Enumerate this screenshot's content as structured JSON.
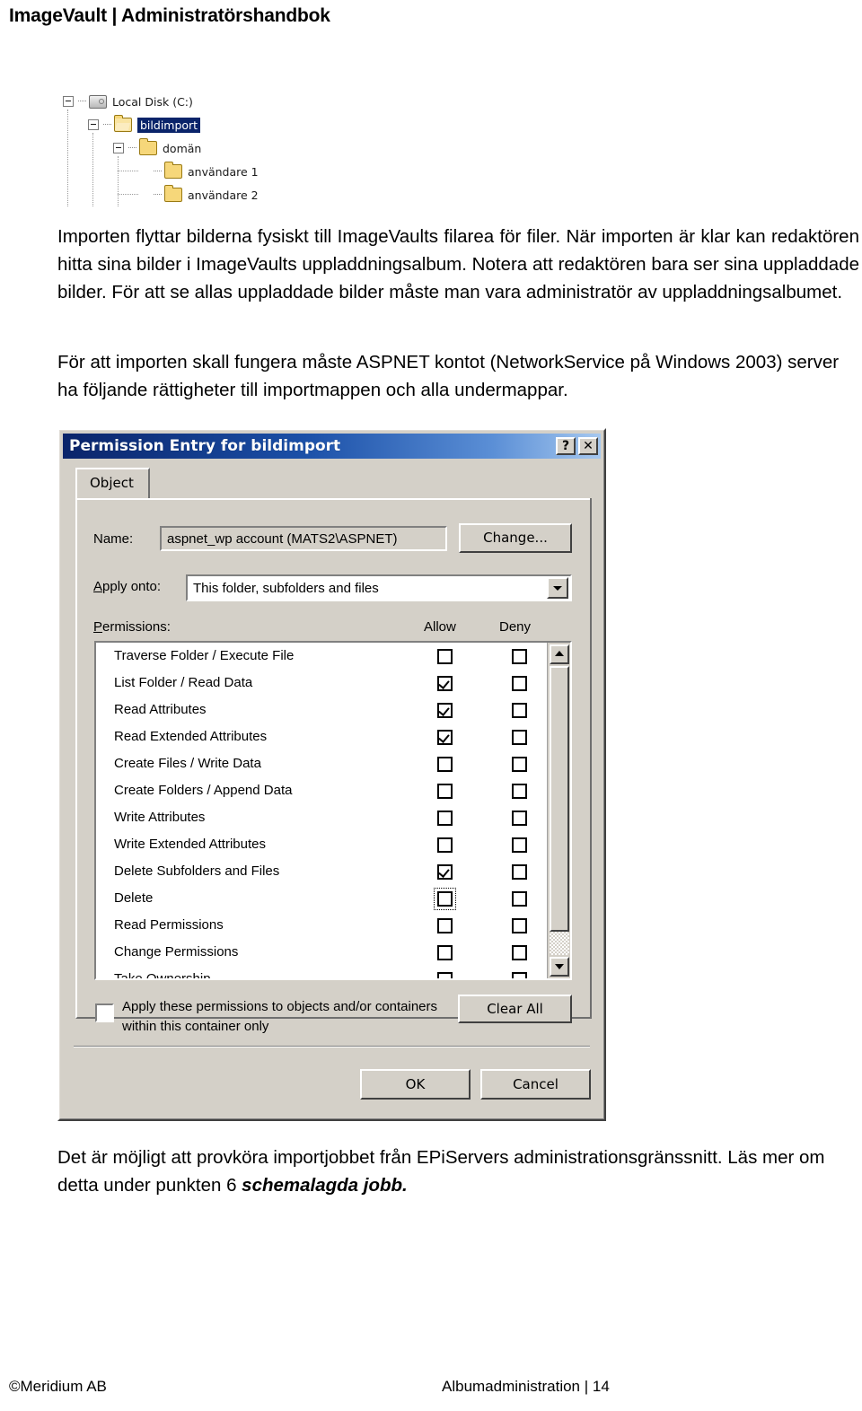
{
  "header": {
    "title": "ImageVault | Administratörshandbok"
  },
  "tree_figure": {
    "nodes": [
      {
        "label": "Local Disk (C:)",
        "icon": "drive-icon",
        "expander": "minus",
        "selected": false
      },
      {
        "label": "bildimport",
        "icon": "folder-open-icon",
        "expander": "minus",
        "selected": true
      },
      {
        "label": "domän",
        "icon": "folder-icon",
        "expander": "minus",
        "selected": false
      },
      {
        "label": "användare 1",
        "icon": "folder-icon",
        "expander": "none",
        "selected": false
      },
      {
        "label": "användare 2",
        "icon": "folder-icon",
        "expander": "none",
        "selected": false
      }
    ]
  },
  "paragraphs": {
    "p1": "Importen flyttar bilderna fysiskt till ImageVaults filarea för filer. När importen är klar kan redaktören hitta sina bilder i ImageVaults uppladdningsalbum. Notera att redaktören bara ser sina uppladdade bilder. För att se allas uppladdade bilder måste man vara administratör av uppladdningsalbumet.",
    "p2": "För att importen skall fungera måste ASPNET kontot (NetworkService på Windows 2003) server ha följande rättigheter till importmappen och alla undermappar.",
    "p3_plain": "Det är möjligt att provköra importjobbet från EPiServers administrationsgränssnitt. Läs mer om detta under punkten 6 ",
    "p3_emphasis": "schemalagda jobb."
  },
  "dialog": {
    "title": "Permission Entry for bildimport",
    "help_button": "?",
    "close_button": "✕",
    "tab": "Object",
    "name_label": "Name:",
    "name_value": "aspnet_wp account (MATS2\\ASPNET)",
    "change_button": "Change...",
    "apply_onto_label": "Apply onto:",
    "apply_onto_value": "This folder, subfolders and files",
    "permissions_label": "Permissions:",
    "allow_header": "Allow",
    "deny_header": "Deny",
    "permissions": [
      {
        "name": "Traverse Folder / Execute File",
        "allow": false,
        "deny": false,
        "focused": false
      },
      {
        "name": "List Folder / Read Data",
        "allow": true,
        "deny": false,
        "focused": false
      },
      {
        "name": "Read Attributes",
        "allow": true,
        "deny": false,
        "focused": false
      },
      {
        "name": "Read Extended Attributes",
        "allow": true,
        "deny": false,
        "focused": false
      },
      {
        "name": "Create Files / Write Data",
        "allow": false,
        "deny": false,
        "focused": false
      },
      {
        "name": "Create Folders / Append Data",
        "allow": false,
        "deny": false,
        "focused": false
      },
      {
        "name": "Write Attributes",
        "allow": false,
        "deny": false,
        "focused": false
      },
      {
        "name": "Write Extended Attributes",
        "allow": false,
        "deny": false,
        "focused": false
      },
      {
        "name": "Delete Subfolders and Files",
        "allow": true,
        "deny": false,
        "focused": false
      },
      {
        "name": "Delete",
        "allow": false,
        "deny": false,
        "focused": true
      },
      {
        "name": "Read Permissions",
        "allow": false,
        "deny": false,
        "focused": false
      },
      {
        "name": "Change Permissions",
        "allow": false,
        "deny": false,
        "focused": false
      },
      {
        "name": "Take Ownership",
        "allow": false,
        "deny": false,
        "focused": false
      }
    ],
    "apply_containers_checkbox": {
      "checked": false,
      "label": "Apply these permissions to objects and/or containers within this container only"
    },
    "clear_all_button": "Clear All",
    "ok_button": "OK",
    "cancel_button": "Cancel"
  },
  "footer": {
    "left": "©Meridium AB",
    "right": "Albumadministration |  14"
  },
  "colors": {
    "titlebar_start": "#0a246a",
    "titlebar_end": "#a6c8ef",
    "dialog_face": "#d4d0c8",
    "selection": "#0a246a",
    "folder": "#f6d77a"
  }
}
